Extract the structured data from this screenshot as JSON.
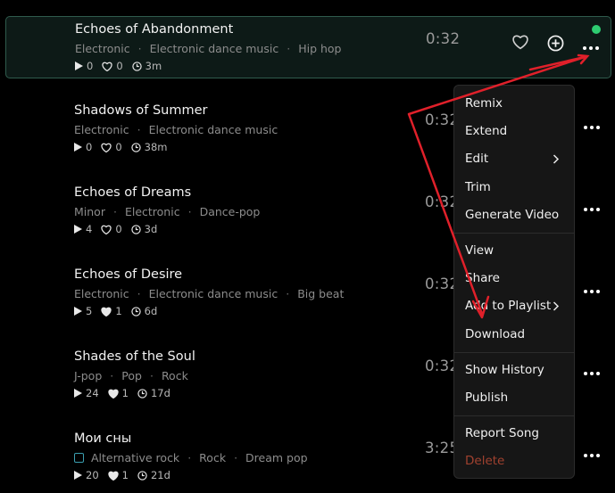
{
  "tracks": [
    {
      "title": "Echoes of Abandonment",
      "tags": [
        "Electronic",
        "Electronic dance music",
        "Hip hop"
      ],
      "plays": "0",
      "likes": "0",
      "age": "3m",
      "duration": "0:32"
    },
    {
      "title": "Shadows of Summer",
      "tags": [
        "Electronic",
        "Electronic dance music"
      ],
      "plays": "0",
      "likes": "0",
      "age": "38m",
      "duration": "0:32"
    },
    {
      "title": "Echoes of Dreams",
      "tags": [
        "Minor",
        "Electronic",
        "Dance-pop"
      ],
      "plays": "4",
      "likes": "0",
      "age": "3d",
      "duration": "0:32"
    },
    {
      "title": "Echoes of Desire",
      "tags": [
        "Electronic",
        "Electronic dance music",
        "Big beat"
      ],
      "plays": "5",
      "likes": "1",
      "age": "6d",
      "duration": "0:32"
    },
    {
      "title": "Shades of the Soul",
      "tags": [
        "J-pop",
        "Pop",
        "Rock"
      ],
      "plays": "24",
      "likes": "1",
      "age": "17d",
      "duration": "0:32"
    },
    {
      "title": "Мои сны",
      "tags": [
        "Alternative rock",
        "Rock",
        "Dream pop"
      ],
      "plays": "20",
      "likes": "1",
      "age": "21d",
      "duration": "3:25"
    }
  ],
  "menu": {
    "remix": "Remix",
    "extend": "Extend",
    "edit": "Edit",
    "trim": "Trim",
    "generate_video": "Generate Video",
    "view": "View",
    "share": "Share",
    "add_to_playlist": "Add to Playlist",
    "download": "Download",
    "show_history": "Show History",
    "publish": "Publish",
    "report_song": "Report Song",
    "delete": "Delete"
  },
  "icons": {
    "play": "play-icon",
    "like": "heart-icon",
    "time": "clock-icon",
    "more": "more-options-icon",
    "add": "add-circle-icon",
    "chevron": "chevron-right-icon"
  },
  "colors": {
    "accent_live": "#2ecc71",
    "selected_border": "#2f5b4d",
    "danger": "#a0412f",
    "annotation": "#e0202a"
  }
}
